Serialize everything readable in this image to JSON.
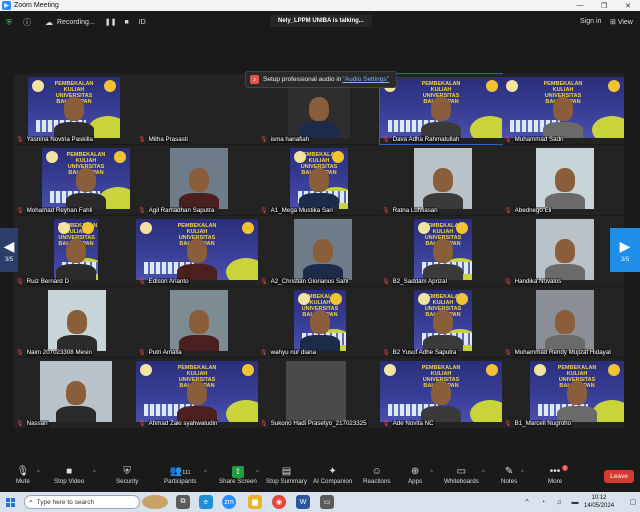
{
  "window": {
    "title": "Zoom Meeting"
  },
  "topbar": {
    "recording_label": "Recording...",
    "id_label": "ID",
    "talking": "Nely_LPPM UNIBA is talking...",
    "signin": "Sign in",
    "view": "View"
  },
  "audio_tip": {
    "prefix": "Setup professional audio in ",
    "link": "\"Audio Settings\""
  },
  "poster": {
    "line1": "PEMBEKALAN",
    "line2": "KULIAH",
    "line3": "UNIVERSITAS",
    "line4": "BALIKPAPAN"
  },
  "participants": [
    {
      "name": "Yasnina Novtria Paskilla",
      "muted": true
    },
    {
      "name": "Mitha Prasasti",
      "muted": true
    },
    {
      "name": "isma hanafiah",
      "muted": true
    },
    {
      "name": "Dava Adha Rahmatullah",
      "muted": true
    },
    {
      "name": "Muhammad Sadri",
      "muted": true
    },
    {
      "name": "Mohamad Reyhan Fahli",
      "muted": true
    },
    {
      "name": "Agil Ramadhan Saputra",
      "muted": true
    },
    {
      "name": "A1_Mega Mustika Sari",
      "muted": true
    },
    {
      "name": "Ratna Luhfiasari",
      "muted": true
    },
    {
      "name": "Abednego Eli",
      "muted": true
    },
    {
      "name": "Ruiz Bernard D",
      "muted": true
    },
    {
      "name": "Edison Arianto",
      "muted": true
    },
    {
      "name": "A2_Christian Glorianus Sani",
      "muted": true
    },
    {
      "name": "B2_Saddam Aprizal",
      "muted": true
    },
    {
      "name": "Handika Novalos",
      "muted": true
    },
    {
      "name": "Naim 207023308 Mesin",
      "muted": true
    },
    {
      "name": "Putri Amalia",
      "muted": true
    },
    {
      "name": "wahyu nur diana",
      "muted": true
    },
    {
      "name": "B2 Yusuf Adhe Saputra",
      "muted": true
    },
    {
      "name": "Muhammad Rendy Mujizat Hidayat",
      "muted": true
    },
    {
      "name": "Nassan",
      "muted": true
    },
    {
      "name": "Ahmad Zaki syahwaludin",
      "muted": true
    },
    {
      "name": "Sukono Hadi Prasetyo_217023325",
      "muted": true
    },
    {
      "name": "Ade Novita NC",
      "muted": true
    },
    {
      "name": "B1_Marcell Nugroho",
      "muted": true
    }
  ],
  "pagination": {
    "left": "3/5",
    "right": "3/5"
  },
  "toolbar": {
    "mute": "Mute",
    "stop_video": "Stop Video",
    "security": "Security",
    "participants": "Participants",
    "participants_count": "111",
    "share_screen": "Share Screen",
    "stop_summary": "Stop Summary",
    "ai_companion": "AI Companion",
    "reactions": "Reactions",
    "apps": "Apps",
    "whiteboards": "Whiteboards",
    "notes": "Notes",
    "more": "More",
    "more_badge": "1",
    "leave": "Leave"
  },
  "taskbar": {
    "search_placeholder": "Type here to search",
    "time": "10:12",
    "date": "14/05/2024"
  },
  "colors": {
    "accent": "#2d8cff",
    "leave": "#d63b2f",
    "share": "#1f9d3f"
  }
}
